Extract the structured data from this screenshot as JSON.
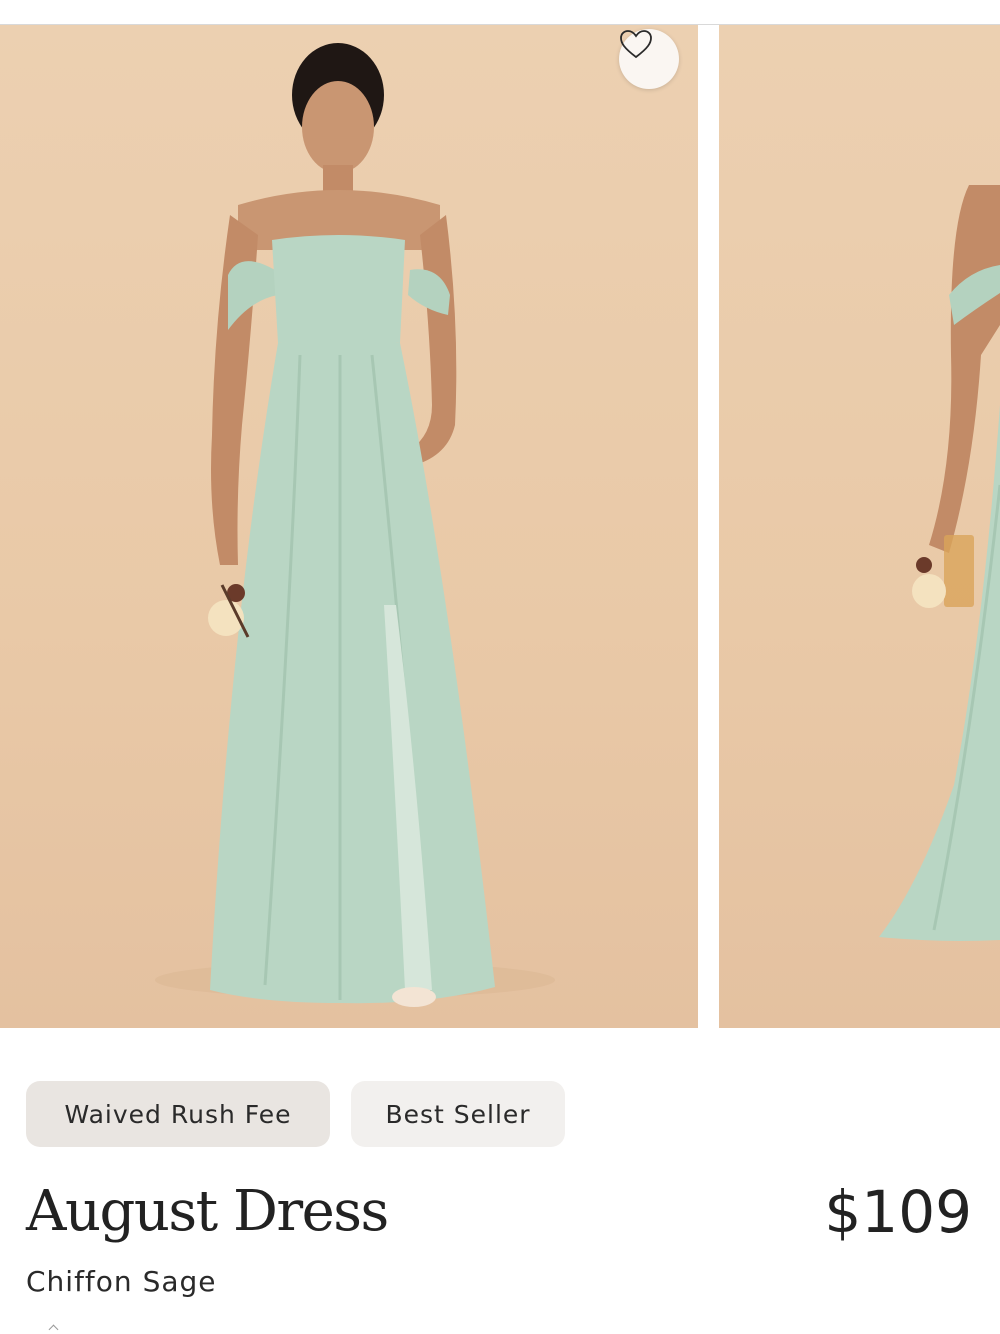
{
  "gallery": {
    "photos": [
      {
        "alt": "August Dress front view"
      },
      {
        "alt": "August Dress side view"
      }
    ],
    "favorite_icon": "heart-icon"
  },
  "badges": {
    "rush": "Waived Rush Fee",
    "best": "Best Seller"
  },
  "product": {
    "name": "August Dress",
    "price": "$109",
    "fabric_color": "Chiffon Sage"
  },
  "colors": {
    "backdrop": "#ecd0b1",
    "dress": "#b9d6c4",
    "skin": "#c99672",
    "text": "#222222",
    "badge_rush_bg": "#e9e5e1",
    "badge_best_bg": "#f2f0ee"
  }
}
